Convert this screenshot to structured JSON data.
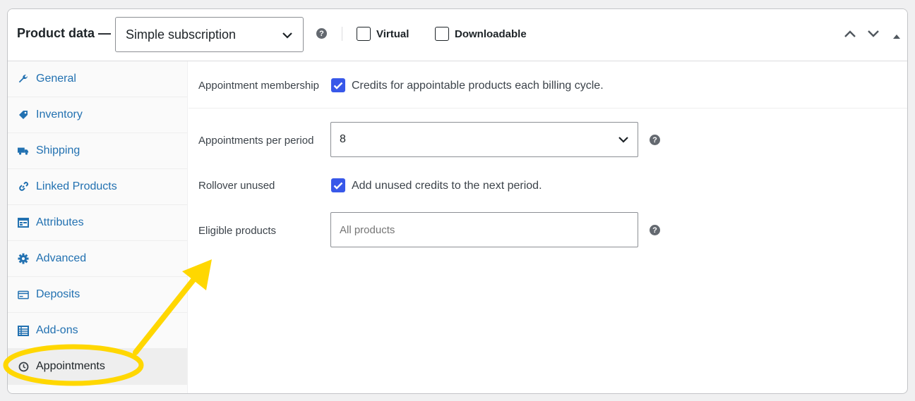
{
  "header": {
    "title": "Product data —",
    "product_type": "Simple subscription",
    "virtual_label": "Virtual",
    "downloadable_label": "Downloadable",
    "help_glyph": "?"
  },
  "sidebar": {
    "items": [
      {
        "label": "General",
        "icon": "wrench-icon"
      },
      {
        "label": "Inventory",
        "icon": "tag-icon"
      },
      {
        "label": "Shipping",
        "icon": "truck-icon"
      },
      {
        "label": "Linked Products",
        "icon": "link-icon"
      },
      {
        "label": "Attributes",
        "icon": "list-table-icon"
      },
      {
        "label": "Advanced",
        "icon": "gear-icon"
      },
      {
        "label": "Deposits",
        "icon": "credit-card-icon"
      },
      {
        "label": "Add-ons",
        "icon": "list-icon"
      },
      {
        "label": "Appointments",
        "icon": "clock-icon",
        "active": true
      }
    ]
  },
  "main": {
    "membership_label": "Appointment membership",
    "membership_checkbox_text": "Credits for appointable products each billing cycle.",
    "per_period_label": "Appointments per period",
    "per_period_value": "8",
    "rollover_label": "Rollover unused",
    "rollover_checkbox_text": "Add unused credits to the next period.",
    "eligible_label": "Eligible products",
    "eligible_placeholder": "All products"
  },
  "colors": {
    "accent": "#3858e9",
    "link": "#2271b1",
    "highlight": "#ffd700"
  }
}
